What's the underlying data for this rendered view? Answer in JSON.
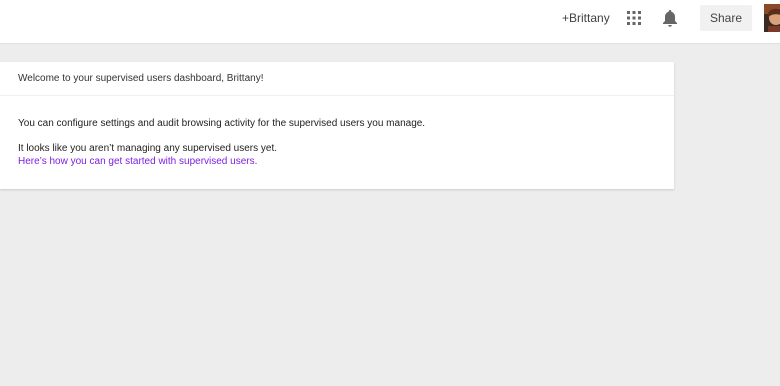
{
  "header": {
    "profile_link": "+Brittany",
    "apps_icon": "apps-grid-icon",
    "notifications_icon": "bell-icon",
    "share_label": "Share",
    "avatar": "avatar-photo"
  },
  "card": {
    "title": "Welcome to your supervised users dashboard, Brittany!",
    "description": "You can configure settings and audit browsing activity for the supervised users you manage.",
    "status": "It looks like you aren’t managing any supervised users yet.",
    "help_link": "Here’s how you can get started with supervised users."
  },
  "colors": {
    "link": "#7b1fe0",
    "page_background": "#ededed",
    "card_background": "#ffffff"
  }
}
